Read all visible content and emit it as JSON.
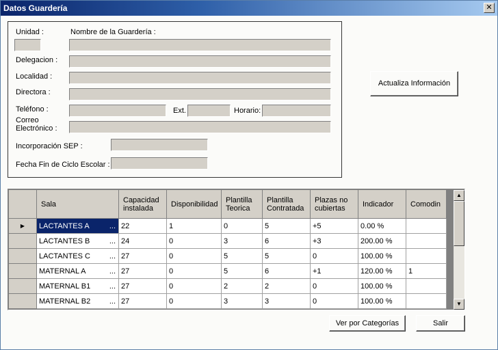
{
  "window": {
    "title": "Datos Guardería",
    "close": "✕"
  },
  "form": {
    "unidad_label": "Unidad :",
    "nombre_label": "Nombre de la Guardería :",
    "delegacion_label": "Delegacion :",
    "localidad_label": "Localidad :",
    "directora_label": "Directora :",
    "telefono_label": "Teléfono :",
    "ext_label": "Ext.",
    "horario_label": "Horario:",
    "correo_label_1": "Correo",
    "correo_label_2": "Electrónico :",
    "incorporacion_label": "Incorporación SEP :",
    "fecha_fin_label": "Fecha Fin de Ciclo Escolar :",
    "values": {
      "unidad": "",
      "nombre": "",
      "delegacion": "",
      "localidad": "",
      "directora": "",
      "telefono": "",
      "ext": "",
      "horario": "",
      "correo": "",
      "incorporacion": "",
      "fecha_fin": ""
    }
  },
  "buttons": {
    "actualiza": "Actualiza Información",
    "ver_categorias": "Ver por Categorías",
    "salir": "Salir"
  },
  "grid": {
    "headers": [
      "Sala",
      "Capacidad instalada",
      "Disponibilidad",
      "Plantilla Teorica",
      "Plantilla Contratada",
      "Plazas no cubiertas",
      "Indicador",
      "Comodin"
    ],
    "ellipsis": "...",
    "current_row_marker": "▶",
    "rows": [
      [
        "LACTANTES A",
        "22",
        "1",
        "0",
        "5",
        "+5",
        "0.00 %",
        ""
      ],
      [
        "LACTANTES B",
        "24",
        "0",
        "3",
        "6",
        "+3",
        "200.00 %",
        ""
      ],
      [
        "LACTANTES C",
        "27",
        "0",
        "5",
        "5",
        "0",
        "100.00 %",
        ""
      ],
      [
        "MATERNAL A",
        "27",
        "0",
        "5",
        "6",
        "+1",
        "120.00 %",
        "1"
      ],
      [
        "MATERNAL B1",
        "27",
        "0",
        "2",
        "2",
        "0",
        "100.00 %",
        ""
      ],
      [
        "MATERNAL B2",
        "27",
        "0",
        "3",
        "3",
        "0",
        "100.00 %",
        ""
      ]
    ]
  },
  "scrollbar": {
    "up": "▲",
    "down": "▼"
  }
}
